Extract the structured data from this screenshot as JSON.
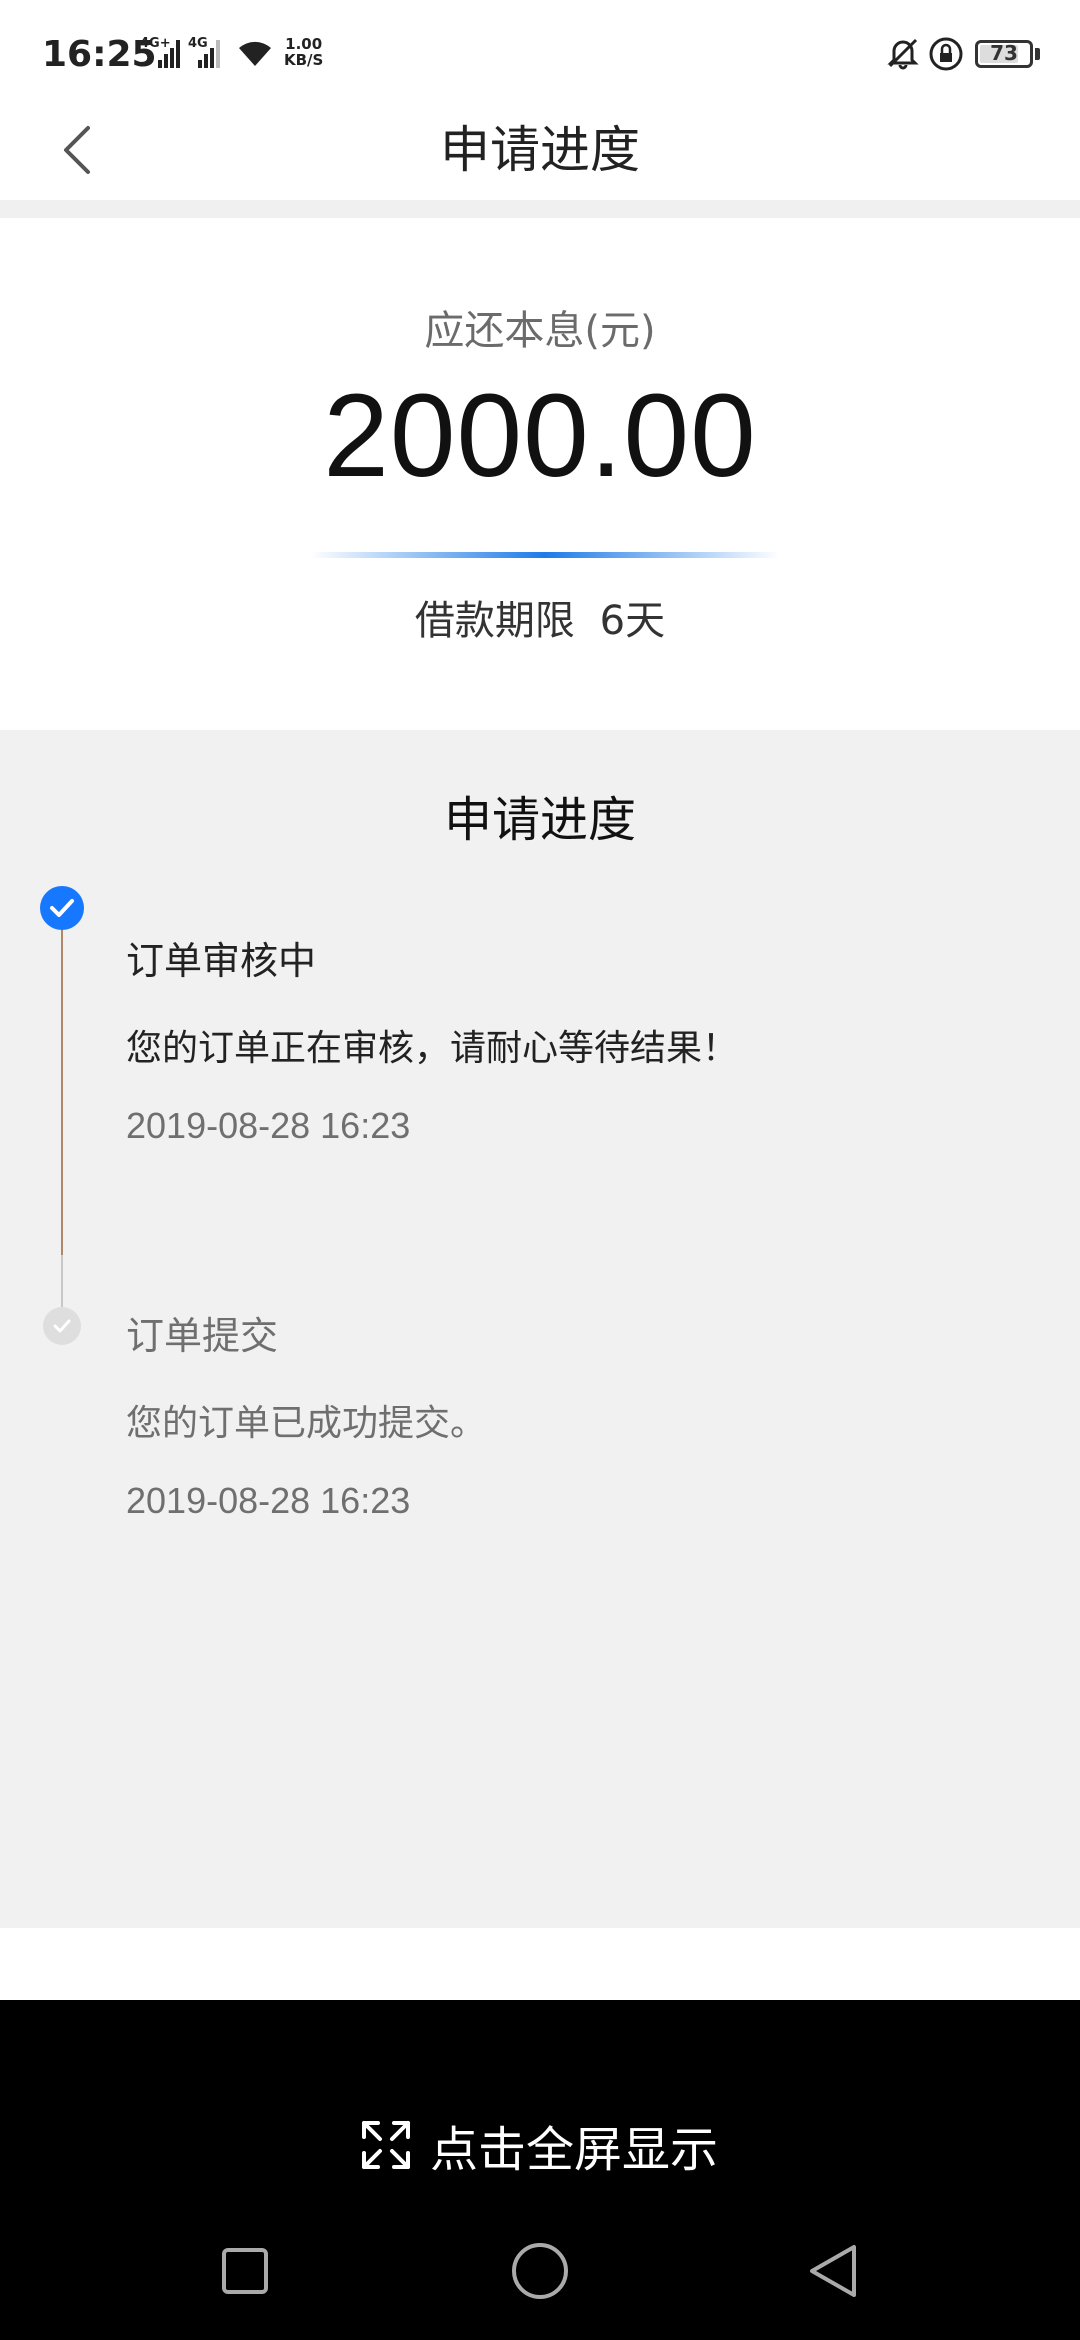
{
  "status_bar": {
    "time": "16:25",
    "network1": "4G+",
    "network2": "4G",
    "speed_value": "1.00",
    "speed_unit": "KB/S",
    "battery": "73"
  },
  "header": {
    "title": "申请进度"
  },
  "amount_card": {
    "label": "应还本息(元)",
    "amount": "2000.00",
    "term_label": "借款期限",
    "term_value": "6天"
  },
  "progress": {
    "title": "申请进度",
    "steps": [
      {
        "title": "订单审核中",
        "description": "您的订单正在审核，请耐心等待结果！",
        "time": "2019-08-28 16:23",
        "state": "active"
      },
      {
        "title": "订单提交",
        "description": "您的订单已成功提交。",
        "time": "2019-08-28 16:23",
        "state": "done"
      }
    ]
  },
  "bottom": {
    "fullscreen_label": "点击全屏显示"
  },
  "colors": {
    "accent": "#1677ff",
    "timeline_active": "#b0876a",
    "section_bg": "#f1f1f1"
  },
  "icons": {
    "back": "chevron-left-icon",
    "fullscreen": "expand-arrows-icon",
    "nav_recent": "square-icon",
    "nav_home": "circle-icon",
    "nav_back": "triangle-left-icon"
  }
}
